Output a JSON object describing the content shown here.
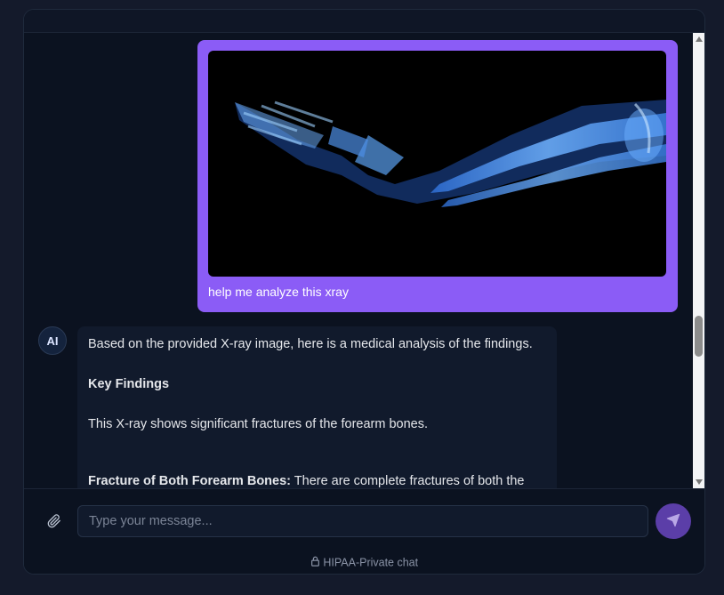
{
  "messages": {
    "user": {
      "text": "help me analyze this xray"
    },
    "ai": {
      "avatar": "AI",
      "intro": "Based on the provided X-ray image, here is a medical analysis of the findings.",
      "heading": "Key Findings",
      "summary": "This X-ray shows significant fractures of the forearm bones.",
      "detail_label": "Fracture of Both Forearm Bones:",
      "detail_text": " There are complete fractures of both the"
    }
  },
  "composer": {
    "placeholder": "Type your message..."
  },
  "footer": {
    "note": "HIPAA-Private chat"
  },
  "icons": {
    "attach": "paperclip-icon",
    "send": "send-icon",
    "lock": "lock-icon",
    "scroll_up": "triangle-up-icon",
    "scroll_down": "triangle-down-icon"
  },
  "colors": {
    "user_bubble": "#8b5cf6",
    "send_button": "#5b3ea8",
    "background": "#0b1220"
  }
}
